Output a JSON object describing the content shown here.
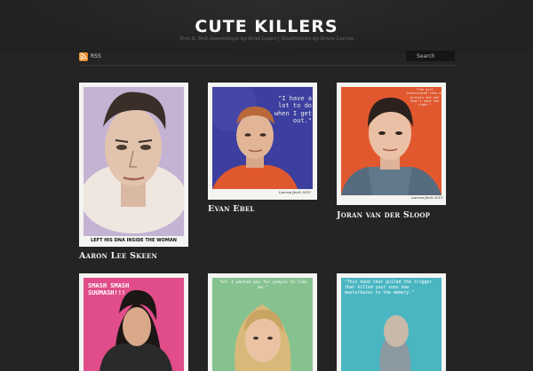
{
  "site": {
    "title": "CUTE KILLERS",
    "tagline": "Text & Text Assemblage by Brad Lopez | Illustrations by Bruce Lacroa"
  },
  "toolbar": {
    "rss_label": "RSS",
    "search_placeholder": "Search"
  },
  "posts": [
    {
      "caption": "Aaron Lee Skeen",
      "inner_caption": "LEFT HIS DNA INSIDE THE WOMAN",
      "bg": "#b9a7c9"
    },
    {
      "caption": "Evan Ebel",
      "quote": "\"I have a lot to do when I get out.\"",
      "signature": "Lacroa fecit 2013",
      "bg": "#3f42a3"
    },
    {
      "caption": "Joran van der Sloop",
      "quote": "\"the girl intoxicated into my private she she didn't have the right.\"",
      "signature": "Lacroa fecit 2013",
      "bg": "#e2582e"
    },
    {
      "caption": "",
      "quote": "SMASH SMASH SUUMASH!!!",
      "bg": "#e34f8b"
    },
    {
      "caption": "",
      "quote": "\"All I wanted was for people to like me.\"",
      "bg": "#8dc596"
    },
    {
      "caption": "",
      "quote": "\"This hand that pulled the trigger that killed your sons now masturbates to the memory.\"",
      "bg": "#4ab8c4"
    }
  ]
}
